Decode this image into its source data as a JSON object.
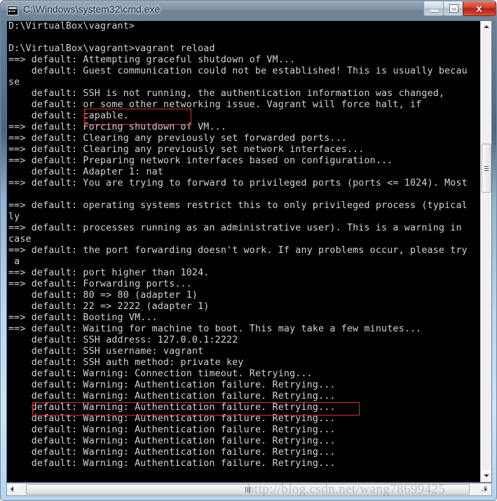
{
  "window": {
    "title": "C:\\Windows\\system32\\cmd.exe",
    "icon": "cmd-console-icon",
    "controls": {
      "minimize_label": "",
      "maximize_label": "",
      "close_label": "x"
    },
    "accent_close_color": "#b42010",
    "title_bar_color": "#4e6579",
    "frame_color": "#bcd6ec"
  },
  "console": {
    "background_color": "#000000",
    "foreground_color": "#d4d4d4",
    "lines": [
      "D:\\VirtualBox\\vagrant>",
      "",
      "D:\\VirtualBox\\vagrant>vagrant reload",
      "==> default: Attempting graceful shutdown of VM...",
      "    default: Guest communication could not be established! This is usually becau",
      "se",
      "    default: SSH is not running, the authentication information was changed,",
      "    default: or some other networking issue. Vagrant will force halt, if",
      "    default: capable.",
      "==> default: Forcing shutdown of VM...",
      "==> default: Clearing any previously set forwarded ports...",
      "==> default: Clearing any previously set network interfaces...",
      "==> default: Preparing network interfaces based on configuration...",
      "    default: Adapter 1: nat",
      "==> default: You are trying to forward to privileged ports (ports <= 1024). Most",
      "",
      "==> default: operating systems restrict this to only privileged process (typical",
      "ly",
      "==> default: processes running as an administrative user). This is a warning in",
      "case",
      "==> default: the port forwarding doesn't work. If any problems occur, please try",
      " a",
      "==> default: port higher than 1024.",
      "==> default: Forwarding ports...",
      "    default: 80 => 80 (adapter 1)",
      "    default: 22 => 2222 (adapter 1)",
      "==> default: Booting VM...",
      "==> default: Waiting for machine to boot. This may take a few minutes...",
      "    default: SSH address: 127.0.0.1:2222",
      "    default: SSH username: vagrant",
      "    default: SSH auth method: private key",
      "    default: Warning: Connection timeout. Retrying...",
      "    default: Warning: Authentication failure. Retrying...",
      "    default: Warning: Authentication failure. Retrying...",
      "    default: Warning: Authentication failure. Retrying...",
      "    default: Warning: Authentication failure. Retrying...",
      "    default: Warning: Authentication failure. Retrying...",
      "    default: Warning: Authentication failure. Retrying...",
      "    default: Warning: Authentication failure. Retrying...",
      "    default: Warning: Authentication failure. Retrying..."
    ]
  },
  "annotations": {
    "color": "#e03030",
    "boxes": [
      {
        "name": "ssh-not-running-highlight",
        "text": "SSH is not running,"
      },
      {
        "name": "authentication-failure-highlight",
        "text": "default: Warning: Authentication failure. Retrying..."
      }
    ]
  },
  "scrollbars": {
    "vertical": {
      "up_arrow": "scroll-up-arrow",
      "down_arrow": "scroll-down-arrow",
      "thumb": "scroll-thumb"
    },
    "horizontal": {
      "left_arrow": "scroll-left-arrow",
      "right_arrow": "scroll-right-arrow",
      "thumb": "scroll-thumb"
    }
  },
  "watermark": {
    "text": "http://blog.csdn.net/wang78699425"
  }
}
